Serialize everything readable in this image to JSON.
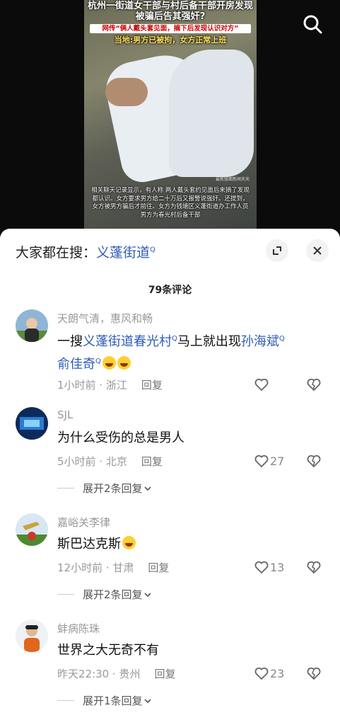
{
  "video": {
    "caption_title": "杭州一街道女干部与村后备干部开房发现被骗后告其强奸?",
    "caption_sub": "网传“俩人戴头套见面，摘下后发现认识对方”",
    "caption_yellow": "当地:男方已被拘，女方正常上班",
    "caption_body": "相关聊天记录显示，有人称 两人戴头套约见面后来摘了发现都认识。女方要求男方给二十万后又报警说强奸。还提到，女方被男方骗后才前往。女方为钱塘区义蓬街道办工作人员男方为春光村后备干部",
    "watermark": "最新版面新闻天天"
  },
  "trending": {
    "prefix": "大家都在搜：",
    "keyword": "义蓬街道",
    "sup": "Q"
  },
  "comments_count": "79条评论",
  "comments": [
    {
      "user": "天朗气清，惠风和畅",
      "text_pre": "一搜",
      "kw1": "义蓬街道春光村",
      "text_mid": "马上就出现",
      "kw2": "孙海斌",
      "kw3": "俞佳奇",
      "sup": "Q",
      "meta": "1小时前 · 浙江",
      "reply": "回复",
      "likes": ""
    },
    {
      "user": "SJL",
      "text": "为什么受伤的总是男人",
      "meta": "5小时前 · 北京",
      "reply": "回复",
      "likes": "27",
      "more": "展开2条回复"
    },
    {
      "user": "嘉峪关李律",
      "text": "斯巴达克斯",
      "meta": "12小时前 · 甘肃",
      "reply": "回复",
      "likes": "13",
      "more": "展开2条回复"
    },
    {
      "user": "蚌病陈珠",
      "text": "世界之大无奇不有",
      "meta": "昨天22:30 · 贵州",
      "reply": "回复",
      "likes": "23",
      "more": "展开1条回复"
    }
  ]
}
